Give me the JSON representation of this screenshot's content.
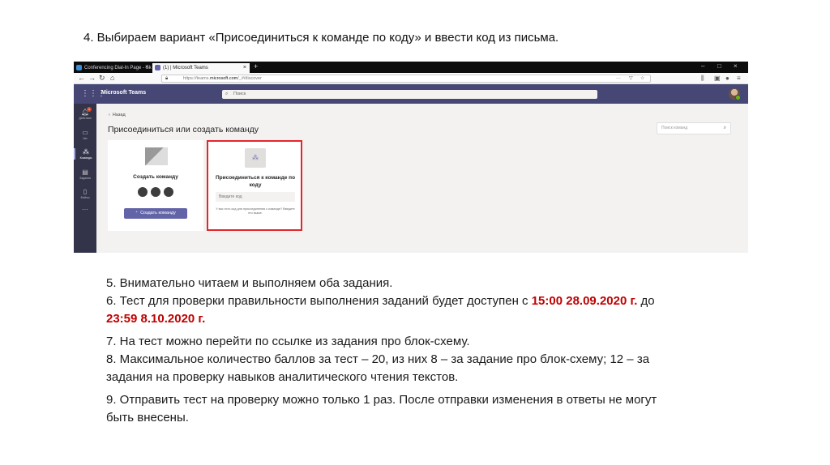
{
  "heading": "4. Выбираем вариант «Присоединиться к команде по коду» и ввести код из письма.",
  "browser": {
    "tabs": [
      {
        "label": "Conferencing Dial-In Page - Sk"
      },
      {
        "label": "(1) | Microsoft Teams"
      }
    ],
    "url_prefix": "https://teams.",
    "url_domain": "microsoft.com",
    "url_path": "/_#/discover"
  },
  "teams": {
    "app_title": "Microsoft Teams",
    "search_placeholder": "Поиск",
    "rail": [
      {
        "label": "Действия",
        "icon": "bell-icon",
        "badge": "1"
      },
      {
        "label": "Чат",
        "icon": "chat-icon"
      },
      {
        "label": "Команды",
        "icon": "teams-icon"
      },
      {
        "label": "Задания",
        "icon": "assignments-icon"
      },
      {
        "label": "Файлы",
        "icon": "files-icon"
      }
    ],
    "back_label": "Назад",
    "page_title": "Присоединиться или создать команду",
    "search_teams_placeholder": "Поиск команд",
    "create_card": {
      "title": "Создать команду",
      "button": "Создать команду"
    },
    "join_card": {
      "title": "Присоединиться к команде по коду",
      "input_placeholder": "Введите код",
      "hint": "У вас есть код для присоединения к команде? Введите его выше."
    }
  },
  "lines": {
    "l5": "5. Внимательно читаем и выполняем оба задания.",
    "l6a": "6. Тест для проверки правильности выполнения заданий будет доступен с ",
    "l6_start": "15:00 28.09.2020 г.",
    "l6b": " до",
    "l6_end": "23:59 8.10.2020 г.",
    "l7": "7. На тест можно перейти по ссылке из задания про блок-схему.",
    "l8a": "8. Максимальное количество баллов за тест – 20, из них 8 – за задание про блок-схему; 12 – за",
    "l8b": "задания на проверку навыков аналитического чтения текстов.",
    "l9a": "9. Отправить тест на проверку можно только 1 раз. После отправки изменения в ответы не могут",
    "l9b": "быть внесены."
  }
}
